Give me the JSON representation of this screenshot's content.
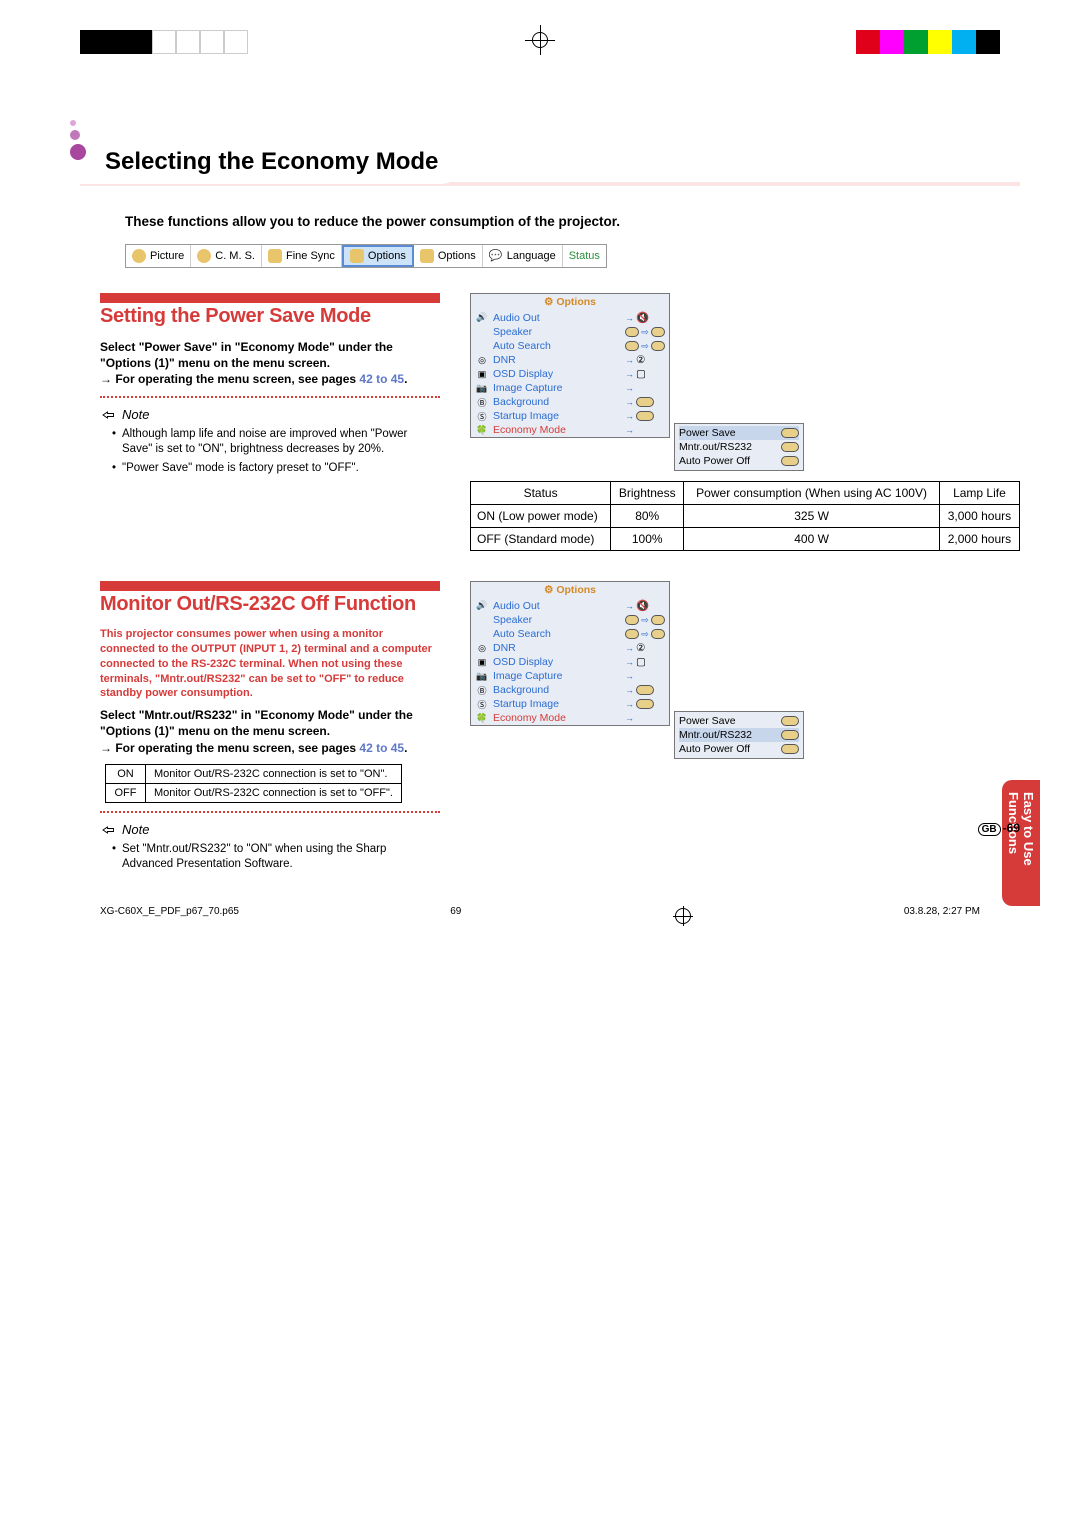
{
  "title": "Selecting the Economy Mode",
  "intro": "These functions allow you to reduce the power consumption of the projector.",
  "tabs": [
    {
      "label": "Picture",
      "color": "#e8d08a"
    },
    {
      "label": "C. M. S.",
      "color": "#e8d08a"
    },
    {
      "label": "Fine Sync",
      "color": "#e8d08a"
    },
    {
      "label": "Options",
      "color": "#e8d08a",
      "active": true
    },
    {
      "label": "Options",
      "color": "#e8d08a"
    },
    {
      "label": "Language",
      "color": "#ffffff"
    },
    {
      "label": "Status",
      "color": "#a8d49a"
    }
  ],
  "section1": {
    "heading": "Setting the Power Save Mode",
    "body1": "Select \"Power Save\" in \"Economy Mode\" under the \"Options (1)\" menu on the menu screen.",
    "body2": "→ For operating the menu screen, see pages ",
    "body2_link": "42 to 45",
    "body2_end": ".",
    "note_label": "Note",
    "notes": [
      "Although lamp life and noise are improved when \"Power Save\" is set to \"ON\", brightness decreases by 20%.",
      "\"Power Save\" mode is factory preset to \"OFF\"."
    ]
  },
  "osd": {
    "title": "Options",
    "rows": [
      {
        "icon": "🔊",
        "label": "Audio Out",
        "val": "→🔇"
      },
      {
        "icon": "",
        "label": "Speaker",
        "val": "sw"
      },
      {
        "icon": "",
        "label": "Auto Search",
        "val": "sw"
      },
      {
        "icon": "◎",
        "label": "DNR",
        "val": "→②"
      },
      {
        "icon": "📺",
        "label": "OSD Display",
        "val": "→▢"
      },
      {
        "icon": "📷",
        "label": "Image Capture",
        "val": "→"
      },
      {
        "icon": "Ⓑ",
        "label": "Background",
        "val": "→▢"
      },
      {
        "icon": "Ⓢ",
        "label": "Startup Image",
        "val": "→▢"
      },
      {
        "icon": "🍀",
        "label": "Economy Mode",
        "val": "→",
        "hl": true
      }
    ]
  },
  "submenu1": {
    "rows": [
      {
        "label": "Power Save",
        "hl": true
      },
      {
        "label": "Mntr.out/RS232"
      },
      {
        "label": "Auto Power Off"
      }
    ]
  },
  "power_table": {
    "headers": [
      "Status",
      "Brightness",
      "Power consumption (When using AC 100V)",
      "Lamp Life"
    ],
    "rows": [
      {
        "status": "ON (Low power mode)",
        "brightness": "80%",
        "power": "325 W",
        "life": "3,000 hours"
      },
      {
        "status": "OFF (Standard mode)",
        "brightness": "100%",
        "power": "400 W",
        "life": "2,000 hours"
      }
    ]
  },
  "section2": {
    "heading": "Monitor Out/RS-232C Off Function",
    "red_text": "This projector consumes power when using a monitor connected to the OUTPUT (INPUT 1, 2) terminal and a computer connected to the RS-232C terminal. When not using these terminals, \"Mntr.out/RS232\" can be set to \"OFF\" to reduce standby power consumption.",
    "body1": "Select \"Mntr.out/RS232\" in \"Economy Mode\" under the \"Options (1)\" menu on the menu screen.",
    "body2": "→ For operating the menu screen, see pages ",
    "body2_link": "42 to 45",
    "body2_end": ".",
    "table": [
      {
        "k": "ON",
        "v": "Monitor Out/RS-232C connection is set to \"ON\"."
      },
      {
        "k": "OFF",
        "v": "Monitor Out/RS-232C connection is set to \"OFF\"."
      }
    ],
    "note_label": "Note",
    "notes": [
      "Set \"Mntr.out/RS232\" to \"ON\" when using the Sharp Advanced Presentation Software."
    ]
  },
  "submenu2": {
    "rows": [
      {
        "label": "Power Save"
      },
      {
        "label": "Mntr.out/RS232",
        "hl": true
      },
      {
        "label": "Auto Power Off"
      }
    ]
  },
  "side_tab": "Easy to Use Functions",
  "page_num_prefix": "GB",
  "page_num": "-69",
  "footer": {
    "left": "XG-C60X_E_PDF_p67_70.p65",
    "center": "69",
    "right": "03.8.28, 2:27 PM"
  },
  "reg_colors_left": [
    "#000",
    "#000",
    "#000",
    "#fff",
    "#fff",
    "#fff",
    "#fff"
  ],
  "reg_colors_right": [
    "#fff",
    "#e0001a",
    "#ff00ff",
    "#00b050",
    "#ffff00",
    "#00b0f0",
    "#000"
  ]
}
